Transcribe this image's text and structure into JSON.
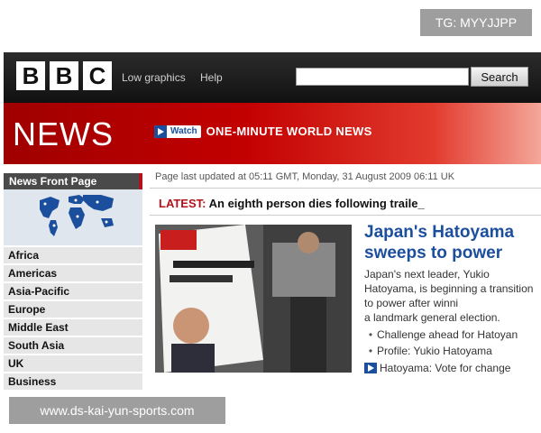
{
  "overlay": {
    "tg_badge": "TG: MYYJJPP",
    "watermark": "www.ds-kai-yun-sports.com"
  },
  "header": {
    "logo_letters": [
      "B",
      "B",
      "C"
    ],
    "low_graphics": "Low graphics",
    "help": "Help",
    "search_placeholder": "",
    "search_button": "Search"
  },
  "newsbar": {
    "title": "NEWS",
    "watch_label": "Watch",
    "watch_headline": "ONE-MINUTE WORLD NEWS"
  },
  "sidebar": {
    "front_page": "News Front Page",
    "items": [
      "Africa",
      "Americas",
      "Asia-Pacific",
      "Europe",
      "Middle East",
      "South Asia",
      "UK",
      "Business"
    ]
  },
  "main": {
    "updated": "Page last updated at 05:11 GMT, Monday, 31 August 2009 06:11 UK",
    "latest_label": "LATEST:",
    "latest_text": "An eighth person dies following traile_",
    "story": {
      "title": "Japan's Hatoyama sweeps to power",
      "summary": "Japan's next leader, Yukio Hatoyama, is beginning a transition to power after winni\na landmark general election.",
      "related": [
        "Challenge ahead for Hatoyan",
        "Profile: Yukio Hatoyama"
      ],
      "video_link": "Hatoyama: Vote for change"
    }
  },
  "colors": {
    "bbc_red": "#b1121b",
    "link_blue": "#1b4f9e"
  },
  "icons": [
    "play-icon",
    "world-map-icon",
    "bullet-icon"
  ]
}
